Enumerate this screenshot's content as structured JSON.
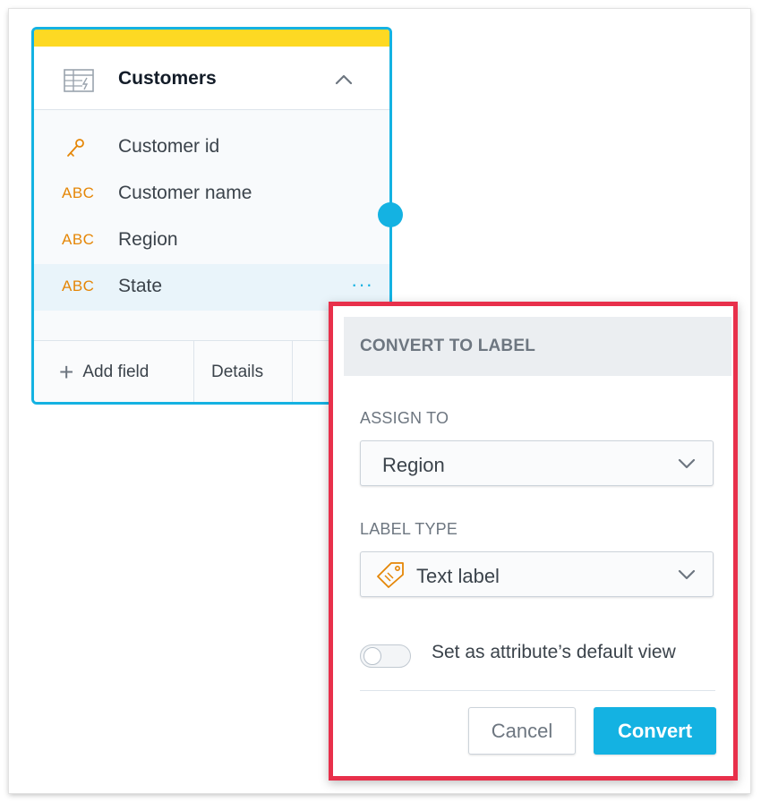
{
  "dataset": {
    "title": "Customers",
    "fields": [
      {
        "label": "Customer id",
        "type": "key"
      },
      {
        "label": "Customer name",
        "type_label": "ABC"
      },
      {
        "label": "Region",
        "type_label": "ABC"
      },
      {
        "label": "State",
        "type_label": "ABC",
        "highlighted": true
      }
    ],
    "footer": {
      "add_field": "Add field",
      "details": "Details"
    },
    "colors": {
      "accent": "#14b2e2",
      "topbar": "#fdd923",
      "type_label": "#e58606"
    }
  },
  "dialog": {
    "title": "CONVERT TO LABEL",
    "assign_to": {
      "label": "ASSIGN TO",
      "value": "Region"
    },
    "label_type": {
      "label": "LABEL TYPE",
      "value": "Text label",
      "icon": "tag-icon"
    },
    "default_view": {
      "label": "Set as attribute’s default view",
      "checked": false
    },
    "buttons": {
      "cancel": "Cancel",
      "convert": "Convert"
    },
    "colors": {
      "outline": "#e8304b",
      "primary": "#14b2e2"
    }
  }
}
